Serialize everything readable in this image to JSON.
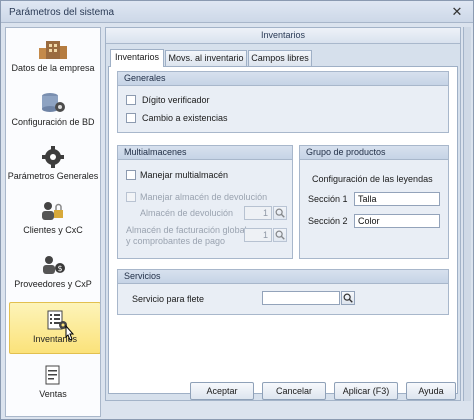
{
  "window": {
    "title": "Parámetros del sistema",
    "close_glyph": "✕"
  },
  "sidebar": {
    "items": [
      {
        "label": "Datos de la empresa",
        "icon": "building-icon"
      },
      {
        "label": "Configuración de BD",
        "icon": "database-gear-icon"
      },
      {
        "label": "Parámetros Generales",
        "icon": "gear-icon"
      },
      {
        "label": "Clientes y CxC",
        "icon": "clients-lock-icon"
      },
      {
        "label": "Proveedores y CxP",
        "icon": "supplier-dollar-icon"
      },
      {
        "label": "Inventarios",
        "icon": "inventory-list-icon",
        "active": true
      },
      {
        "label": "Ventas",
        "icon": "receipt-icon"
      }
    ]
  },
  "main": {
    "header": "Inventarios",
    "tabs": [
      {
        "label": "Inventarios",
        "active": true
      },
      {
        "label": "Movs. al inventario"
      },
      {
        "label": "Campos libres"
      }
    ],
    "generales": {
      "title": "Generales",
      "digito_verificador": "Dígito verificador",
      "cambio_existencias": "Cambio a existencias"
    },
    "multialmacenes": {
      "title": "Multialmacenes",
      "manejar_multialmacen": "Manejar multialmacén",
      "manejar_almacen_devolucion": "Manejar almacén de devolución",
      "almacen_devolucion_label": "Almacén de devolución",
      "almacen_devolucion_value": "1",
      "almacen_facturacion_label_1": "Almacén de facturación global",
      "almacen_facturacion_label_2": "y comprobantes de pago",
      "almacen_facturacion_value": "1"
    },
    "grupo_productos": {
      "title": "Grupo de productos",
      "subtitle": "Configuración de las leyendas",
      "seccion1_label": "Sección 1",
      "seccion1_value": "Talla",
      "seccion2_label": "Sección 2",
      "seccion2_value": "Color"
    },
    "servicios": {
      "title": "Servicios",
      "servicio_flete_label": "Servicio para flete",
      "servicio_flete_value": ""
    },
    "footer": {
      "aceptar": "Aceptar",
      "cancelar": "Cancelar",
      "aplicar": "Aplicar (F3)",
      "ayuda": "Ayuda"
    }
  },
  "colors": {
    "accent_active": "#fbe27a",
    "group_header": "#c6d4e6",
    "window_bg": "#dbe3ee"
  }
}
